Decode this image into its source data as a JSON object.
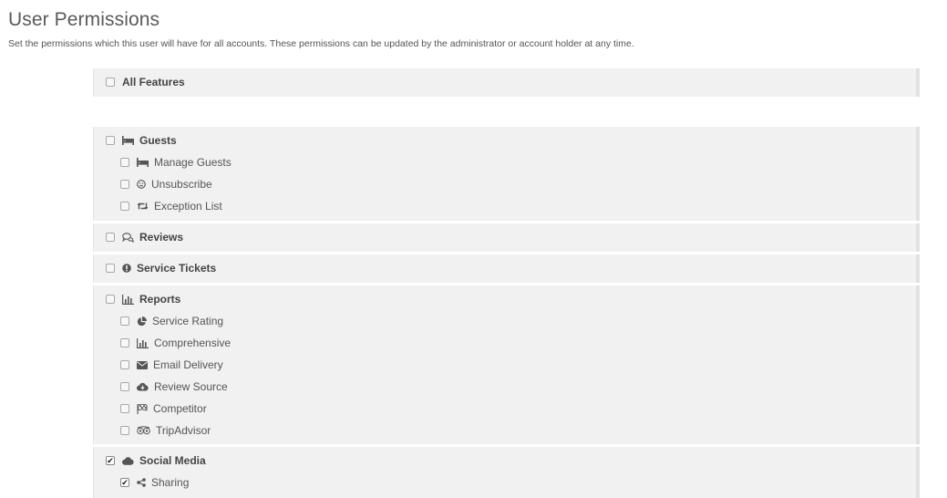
{
  "page": {
    "title": "User Permissions",
    "subtitle": "Set the permissions which this user will have for all accounts. These permissions can be updated by the administrator or account holder at any time."
  },
  "all_features": {
    "label": "All Features",
    "checked": false
  },
  "groups": [
    {
      "label": "Guests",
      "icon": "bed-icon",
      "checked": false,
      "children": [
        {
          "label": "Manage Guests",
          "icon": "bed-icon",
          "checked": false
        },
        {
          "label": "Unsubscribe",
          "icon": "frown-icon",
          "checked": false
        },
        {
          "label": "Exception List",
          "icon": "retweet-icon",
          "checked": false
        }
      ]
    },
    {
      "label": "Reviews",
      "icon": "comments-icon",
      "checked": false,
      "children": []
    },
    {
      "label": "Service Tickets",
      "icon": "exclamation-circle-icon",
      "checked": false,
      "children": []
    },
    {
      "label": "Reports",
      "icon": "bar-chart-icon",
      "checked": false,
      "children": [
        {
          "label": "Service Rating",
          "icon": "pie-chart-icon",
          "checked": false
        },
        {
          "label": "Comprehensive",
          "icon": "bar-chart-icon",
          "checked": false
        },
        {
          "label": "Email Delivery",
          "icon": "envelope-icon",
          "checked": false
        },
        {
          "label": "Review Source",
          "icon": "cloud-download-icon",
          "checked": false
        },
        {
          "label": "Competitor",
          "icon": "flag-checkered-icon",
          "checked": false
        },
        {
          "label": "TripAdvisor",
          "icon": "tripadvisor-icon",
          "checked": false
        }
      ]
    },
    {
      "label": "Social Media",
      "icon": "cloud-icon",
      "checked": true,
      "children": [
        {
          "label": "Sharing",
          "icon": "share-icon",
          "checked": true
        }
      ]
    }
  ]
}
